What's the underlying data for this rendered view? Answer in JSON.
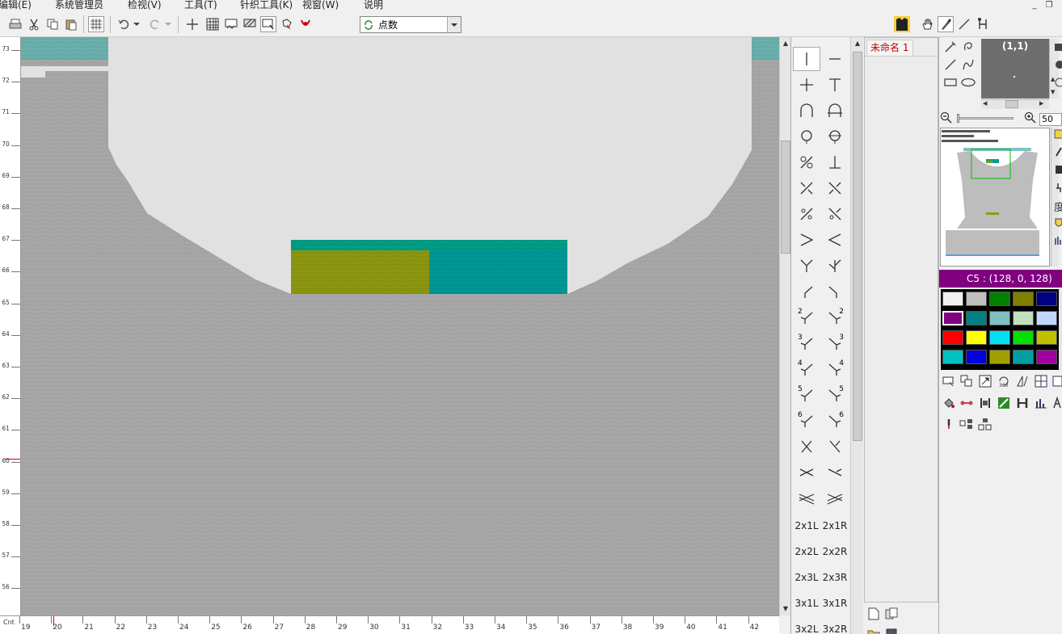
{
  "menu": [
    "编辑(E)",
    "系统管理员",
    "检视(V)",
    "工具(T)",
    "针织工具(K)",
    "视窗(W)",
    "说明"
  ],
  "window_controls": [
    "_",
    "❐"
  ],
  "toolbar": {
    "combo_value": "点数"
  },
  "canvas": {
    "row_labels": [
      "73",
      "72",
      "71",
      "70",
      "69",
      "68",
      "67",
      "66",
      "65",
      "64",
      "63",
      "62",
      "61",
      "60",
      "59",
      "58",
      "57",
      "56"
    ],
    "col_labels": [
      "19",
      "20",
      "21",
      "22",
      "23",
      "24",
      "25",
      "26",
      "27",
      "28",
      "29",
      "30",
      "31",
      "32",
      "33",
      "34",
      "35",
      "36",
      "37",
      "38",
      "39",
      "40",
      "41",
      "42"
    ],
    "ruler_corner": "Cnt"
  },
  "stitch_panel": {
    "labels": [
      "2x1L",
      "2x1R",
      "2x2L",
      "2x2R",
      "2x3L",
      "2x3R",
      "3x1L",
      "3x1R",
      "3x2L",
      "3x2R"
    ],
    "numbers": [
      "2",
      "2",
      "3",
      "3",
      "4",
      "4",
      "5",
      "5",
      "6",
      "6"
    ]
  },
  "document": {
    "tab_label": "未命名 1"
  },
  "zoom": {
    "coord": "(1,1)",
    "value": "50"
  },
  "color_header": "C5 : (128, 0, 128)",
  "side_chars": [
    "度"
  ],
  "colors": {
    "background_knit": "#a9a9a9",
    "canvas_bg": "#e1e1e1",
    "teal": "#00a088",
    "olive": "#8f9a10",
    "teal_dark": "#009a9a",
    "header_purple": "#800080"
  },
  "palette": [
    [
      "#f0f0f0",
      "#c0c0c0",
      "#008000",
      "#808000",
      "#000080"
    ],
    [
      "#800080",
      "#008080",
      "#80c0c0",
      "#c0e0c0",
      "#c0d8ff"
    ],
    [
      "#ff0000",
      "#ffff00",
      "#00e0f0",
      "#00e000",
      "#c0c000"
    ],
    [
      "#00c0c0",
      "#0000e0",
      "#a0a000",
      "#00a0a0",
      "#a000a0"
    ]
  ]
}
